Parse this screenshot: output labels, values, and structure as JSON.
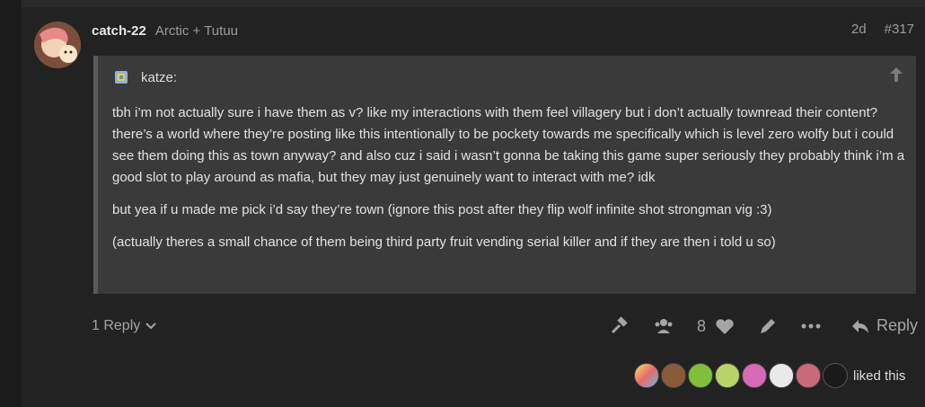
{
  "post": {
    "username": "catch-22",
    "full_name": "Arctic + Tutuu",
    "age": "2d",
    "post_number": "#317"
  },
  "quote": {
    "author": "katze:",
    "paragraphs": [
      "tbh i’m not actually sure i have them as v? like my interactions with them feel villagery but i don’t actually townread their content? there’s a world where they’re posting like this intentionally to be pockety towards me specifically which is level zero wolfy but i could see them doing this as town anyway? and also cuz i said i wasn’t gonna be taking this game super seriously they probably think i’m a good slot to play around as mafia, but they may just genuinely want to interact with me? idk",
      "but yea if u made me pick i’d say they’re town (ignore this post after they flip wolf infinite shot strongman vig :3)",
      "(actually theres a small chance of them being third party fruit vending serial killer and if they are then i told u so)"
    ]
  },
  "actions": {
    "replies_label": "1 Reply",
    "like_count": "8",
    "reply_label": "Reply"
  },
  "likes": {
    "text": "liked this",
    "avatar_colors": [
      "#d0a24a",
      "#8a5a3a",
      "#7fbf3a",
      "#b7d36a",
      "#d66ab7",
      "#e9e9e9",
      "#c96a7a",
      "#1a1a1a"
    ]
  }
}
